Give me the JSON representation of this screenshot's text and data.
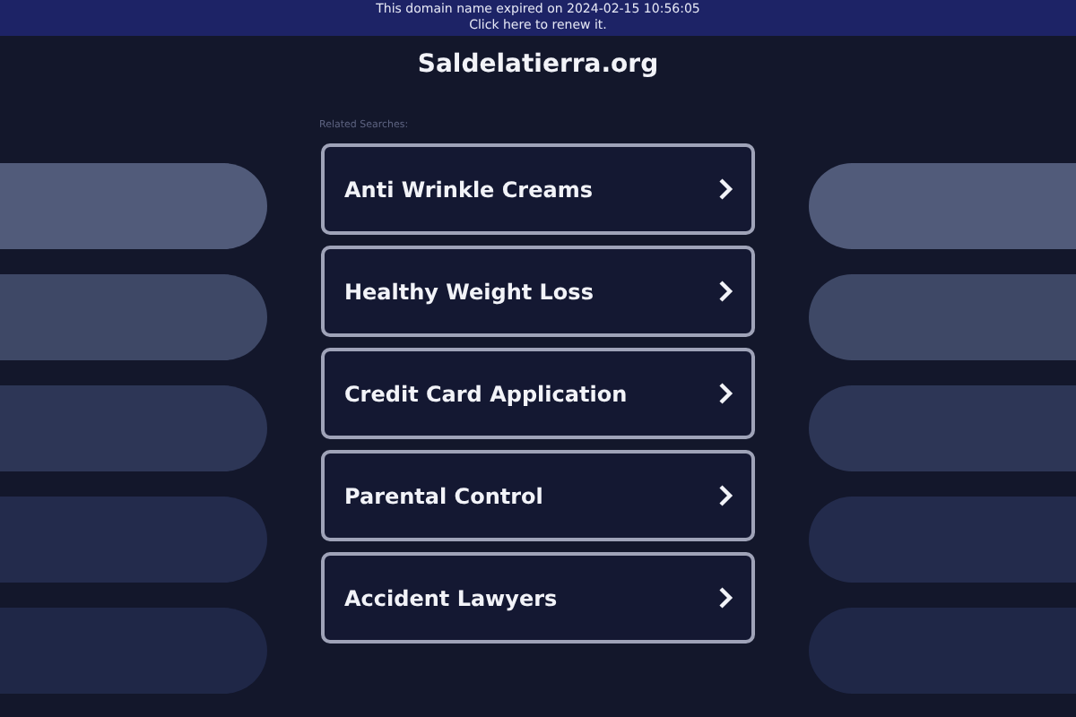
{
  "banner": {
    "line_1": "This domain name expired on 2024-02-15 10:56:05",
    "line_2": "Click here to renew it."
  },
  "site_title": "Saldelatierra.org",
  "related_label": "Related Searches:",
  "links": [
    {
      "label": "Anti Wrinkle Creams"
    },
    {
      "label": "Healthy Weight Loss"
    },
    {
      "label": "Credit Card Application"
    },
    {
      "label": "Parental Control"
    },
    {
      "label": "Accident Lawyers"
    }
  ]
}
